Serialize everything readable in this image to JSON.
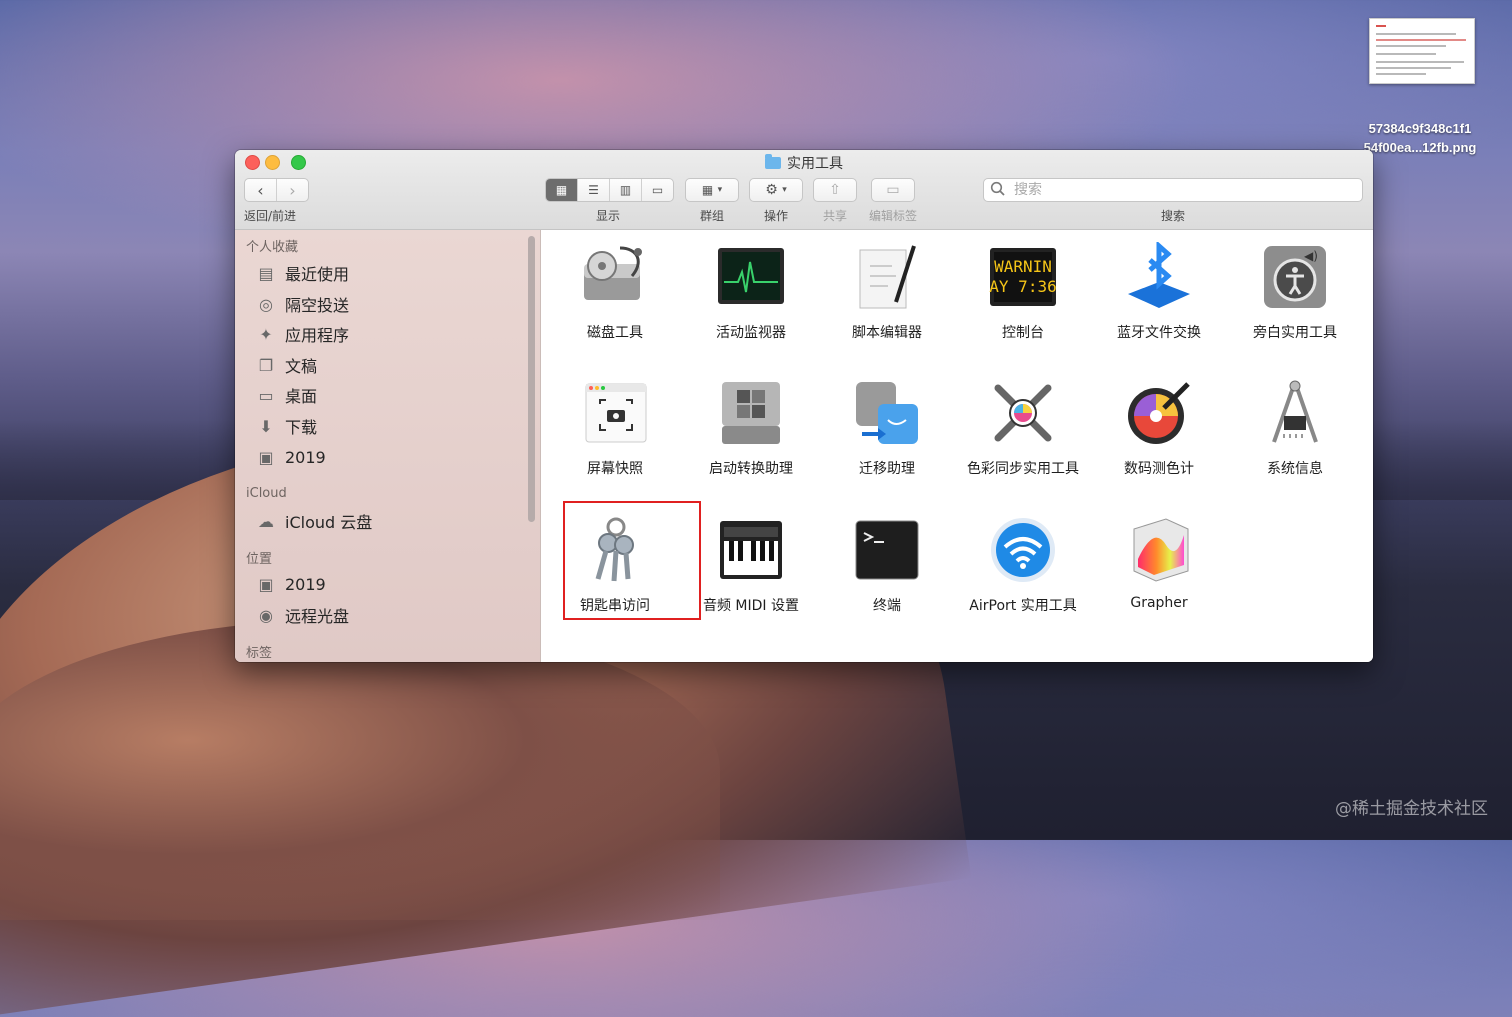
{
  "desktop": {
    "file_name_line1": "57384c9f348c1f1",
    "file_name_line2": "54f00ea...12fb.png",
    "watermark": "@稀土掘金技术社区"
  },
  "window": {
    "title": "实用工具",
    "toolbar": {
      "back_forward_label": "返回/前进",
      "view_label": "显示",
      "group_label": "群组",
      "action_label": "操作",
      "share_label": "共享",
      "tags_label": "编辑标签",
      "search_label": "搜索",
      "search_placeholder": "搜索"
    },
    "sidebar": {
      "favorites_header": "个人收藏",
      "favorites": [
        {
          "label": "最近使用",
          "icon": "recents-icon"
        },
        {
          "label": "隔空投送",
          "icon": "airdrop-icon"
        },
        {
          "label": "应用程序",
          "icon": "applications-icon"
        },
        {
          "label": "文稿",
          "icon": "documents-icon"
        },
        {
          "label": "桌面",
          "icon": "desktop-icon"
        },
        {
          "label": "下载",
          "icon": "downloads-icon"
        },
        {
          "label": "2019",
          "icon": "disk-icon"
        }
      ],
      "icloud_header": "iCloud",
      "icloud": [
        {
          "label": "iCloud 云盘",
          "icon": "cloud-icon"
        }
      ],
      "locations_header": "位置",
      "locations": [
        {
          "label": "2019",
          "icon": "disk-icon"
        },
        {
          "label": "远程光盘",
          "icon": "remote-disc-icon"
        }
      ],
      "tags_header": "标签"
    },
    "apps": [
      "磁盘工具",
      "活动监视器",
      "脚本编辑器",
      "控制台",
      "蓝牙文件交换",
      "旁白实用工具",
      "屏幕快照",
      "启动转换助理",
      "迁移助理",
      "色彩同步实用工具",
      "数码测色计",
      "系统信息",
      "钥匙串访问",
      "音频 MIDI 设置",
      "终端",
      "AirPort 实用工具",
      "Grapher"
    ],
    "console_icon_text": [
      "WARNIN",
      "AY 7:36"
    ],
    "selected_app": "钥匙串访问"
  }
}
